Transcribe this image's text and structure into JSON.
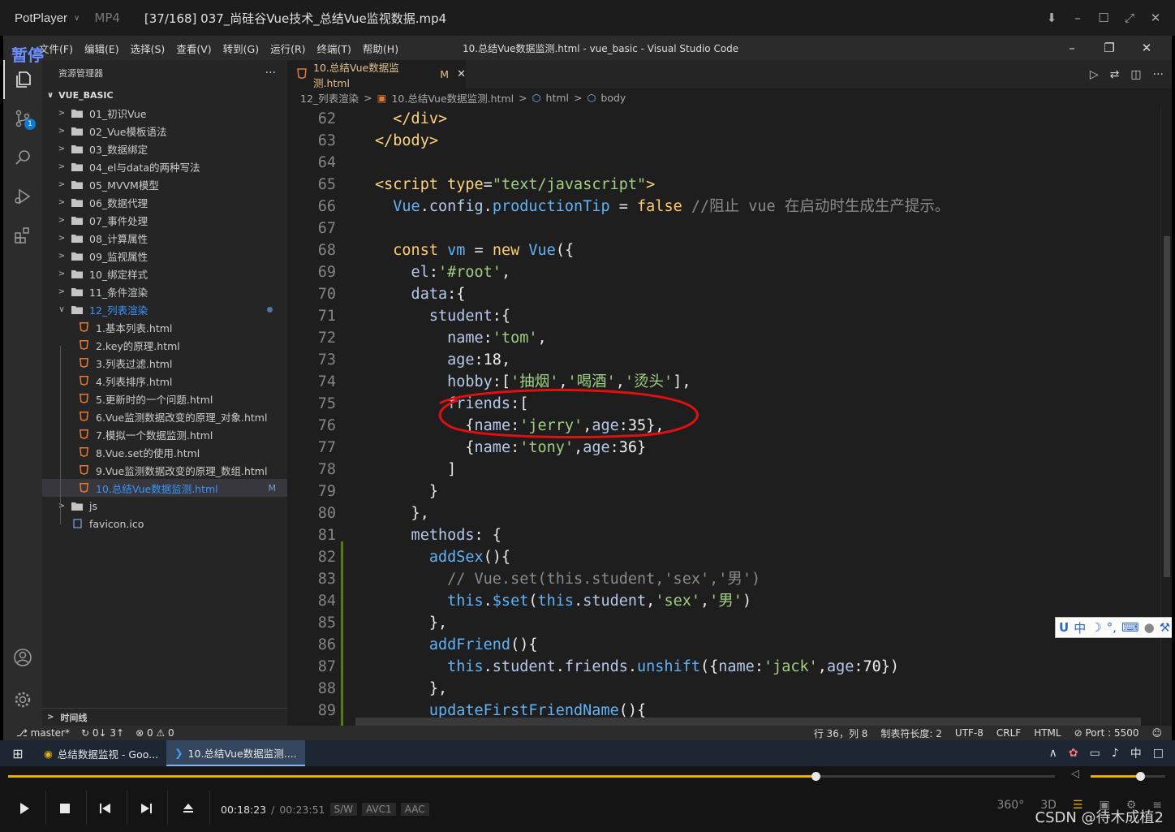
{
  "potplayer": {
    "brand": "PotPlayer",
    "format": "MP4",
    "file_title": "[37/168] 037_尚硅谷Vue技术_总结Vue监视数据.mp4"
  },
  "vscode": {
    "pause_label": "暂停",
    "menu": [
      "文件(F)",
      "编辑(E)",
      "选择(S)",
      "查看(V)",
      "转到(G)",
      "运行(R)",
      "终端(T)",
      "帮助(H)"
    ],
    "window_title": "10.总结Vue数据监测.html - vue_basic - Visual Studio Code",
    "explorer_title": "资源管理器",
    "project_name": "VUE_BASIC",
    "scm_badge": "1",
    "folders": [
      "01_初识Vue",
      "02_Vue模板语法",
      "03_数据绑定",
      "04_el与data的两种写法",
      "05_MVVM模型",
      "06_数据代理",
      "07_事件处理",
      "08_计算属性",
      "09_监视属性",
      "10_绑定样式",
      "11_条件渲染"
    ],
    "open_folder": "12_列表渲染",
    "files": [
      "1.基本列表.html",
      "2.key的原理.html",
      "3.列表过滤.html",
      "4.列表排序.html",
      "5.更新时的一个问题.html",
      "6.Vue监测数据改变的原理_对象.html",
      "7.模拟一个数据监测.html",
      "8.Vue.set的使用.html",
      "9.Vue监测数据改变的原理_数组.html"
    ],
    "active_file": "10.总结Vue数据监测.html",
    "active_file_status": "M",
    "other_items": [
      "js",
      "favicon.ico"
    ],
    "timeline_label": "时间线",
    "tab_label": "10.总结Vue数据监测.html",
    "tab_status": "M",
    "breadcrumb": [
      "12_列表渲染",
      "10.总结Vue数据监测.html",
      "html",
      "body"
    ],
    "line_numbers": [
      62,
      63,
      64,
      65,
      66,
      67,
      68,
      69,
      70,
      71,
      72,
      73,
      74,
      75,
      76,
      77,
      78,
      79,
      80,
      81,
      82,
      83,
      84,
      85,
      86,
      87,
      88,
      89
    ],
    "status_bar": {
      "branch": "master*",
      "sync": "0↓ 3↑",
      "problems": "0",
      "warnings": "0",
      "cursor": "行 36，列 8",
      "tab_size": "制表符长度: 2",
      "encoding": "UTF-8",
      "eol": "CRLF",
      "language": "HTML",
      "port": "Port : 5500"
    }
  },
  "ime": {
    "lang": "中"
  },
  "taskbar": {
    "items": [
      "总结数据监视 - Goo...",
      "10.总结Vue数据监测...."
    ],
    "ime_lang": "中"
  },
  "player_controls": {
    "current_time": "00:18:23",
    "total_time": "00:23:51",
    "badges": [
      "S/W",
      "AVC1",
      "AAC"
    ],
    "progress": 0.771,
    "volume": 0.66,
    "view_labels": [
      "360°",
      "3D"
    ],
    "watermark": "CSDN @待木成植2"
  },
  "colors": {
    "accent_blue": "#3794ff",
    "modified": "#e2c08d",
    "seek_fill": "#e8b100",
    "annotation": "#e01010"
  }
}
